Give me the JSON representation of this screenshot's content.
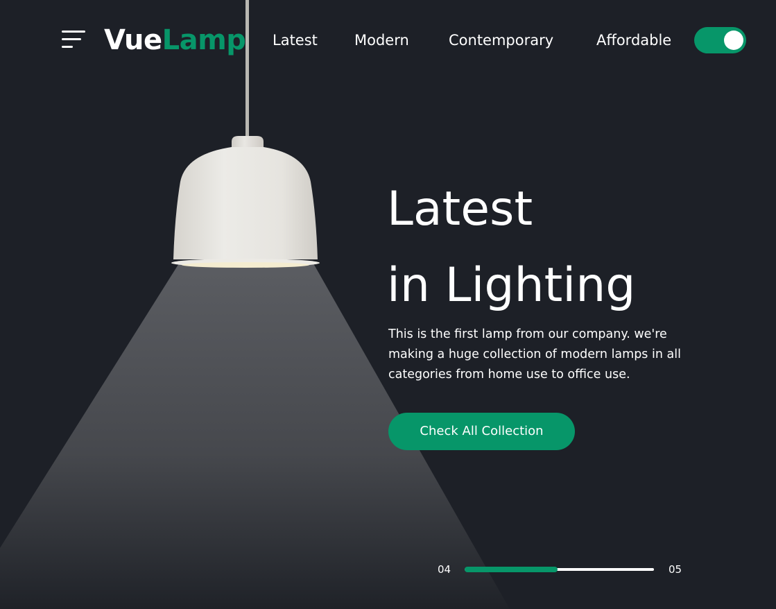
{
  "brand": {
    "part1": "Vue",
    "part2": "Lamp"
  },
  "nav": {
    "links": [
      "Latest",
      "Modern",
      "Contemporary",
      "Affordable"
    ]
  },
  "theme_toggle": {
    "on": true
  },
  "hero": {
    "line1": "Latest",
    "line2": "in Lighting",
    "description": "This is the first lamp from our company. we're making a huge collection of modern lamps in all categories from home use to office use.",
    "cta_label": "Check All Collection"
  },
  "slider": {
    "current": "04",
    "total": "05",
    "progress": 0.49
  },
  "colors": {
    "background": "#1d2027",
    "accent": "#079669",
    "text": "#ffffff",
    "lamp_shade": "#e8e6e1"
  },
  "icons": {
    "menu": "menu-icon",
    "toggle": "toggle-switch"
  }
}
